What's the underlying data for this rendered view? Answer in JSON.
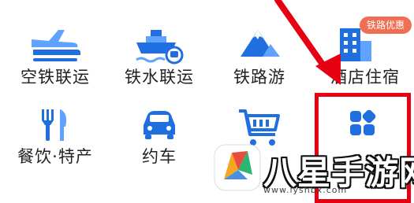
{
  "grid": {
    "row1": [
      {
        "label": "空铁联运",
        "icon": "plane-train-icon"
      },
      {
        "label": "铁水联运",
        "icon": "ship-train-icon"
      },
      {
        "label": "铁路游",
        "icon": "mountain-icon"
      },
      {
        "label": "酒店住宿",
        "icon": "building-icon",
        "badge": "铁路优惠"
      }
    ],
    "row2": [
      {
        "label": "餐饮·特产",
        "icon": "fork-knife-icon"
      },
      {
        "label": "约车",
        "icon": "car-icon"
      },
      {
        "label": "",
        "icon": "cart-icon"
      },
      {
        "label": "",
        "icon": "grid-more-icon"
      }
    ]
  },
  "watermark": {
    "title": "八星手游网",
    "url": "www.lyshbx.com"
  },
  "colors": {
    "icon_blue": "#1f6fe0",
    "icon_light_blue": "#5fa2ff",
    "badge_bg": "#ef6f55",
    "annotation_red": "#e60012"
  }
}
